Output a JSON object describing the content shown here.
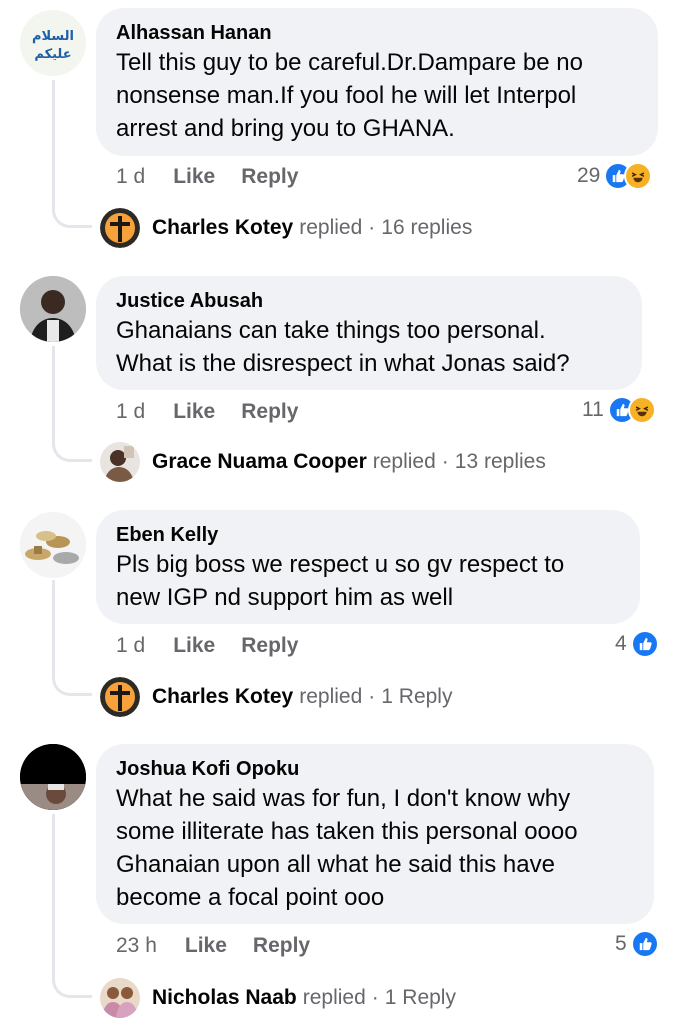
{
  "comments": [
    {
      "author": "Alhassan Hanan",
      "text_lines": [
        "Tell this guy to be careful.Dr.Dampare be no",
        "nonsense man.If you fool he will let Interpol",
        "arrest and bring you to GHANA."
      ],
      "time": "1 d",
      "like_label": "Like",
      "reply_label": "Reply",
      "reaction_count": "29",
      "reactions": [
        "like-icon",
        "haha-icon"
      ],
      "avatar_text": "السلام عليكم",
      "reply_summary": {
        "name": "Charles Kotey",
        "verb": "replied",
        "sep": "·",
        "count": "16 replies"
      }
    },
    {
      "author": "Justice Abusah",
      "text_lines": [
        "Ghanaians can take things too personal.",
        "What is the disrespect in what Jonas said?"
      ],
      "time": "1 d",
      "like_label": "Like",
      "reply_label": "Reply",
      "reaction_count": "11",
      "reactions": [
        "like-icon",
        "haha-icon"
      ],
      "reply_summary": {
        "name": "Grace Nuama Cooper",
        "verb": "replied",
        "sep": "·",
        "count": "13 replies"
      }
    },
    {
      "author": "Eben Kelly",
      "text_lines": [
        "Pls big boss we respect u so gv respect to",
        "new IGP nd support him as well"
      ],
      "time": "1 d",
      "like_label": "Like",
      "reply_label": "Reply",
      "reaction_count": "4",
      "reactions": [
        "like-icon"
      ],
      "reply_summary": {
        "name": "Charles Kotey",
        "verb": "replied",
        "sep": "·",
        "count": "1 Reply"
      }
    },
    {
      "author": "Joshua Kofi Opoku",
      "text_lines": [
        "What he said was for fun, I don't know why",
        "some illiterate has taken this personal oooo",
        "Ghanaian upon all what he said this have",
        "become a focal point ooo"
      ],
      "time": "23 h",
      "like_label": "Like",
      "reply_label": "Reply",
      "reaction_count": "5",
      "reactions": [
        "like-icon"
      ],
      "reply_summary": {
        "name": "Nicholas Naab",
        "verb": "replied",
        "sep": "·",
        "count": "1 Reply"
      }
    }
  ],
  "colors": {
    "bubble": "#f0f2f5",
    "muted_text": "#65676b",
    "like_blue": "#1877f2",
    "haha_yellow": "#f7b125"
  }
}
